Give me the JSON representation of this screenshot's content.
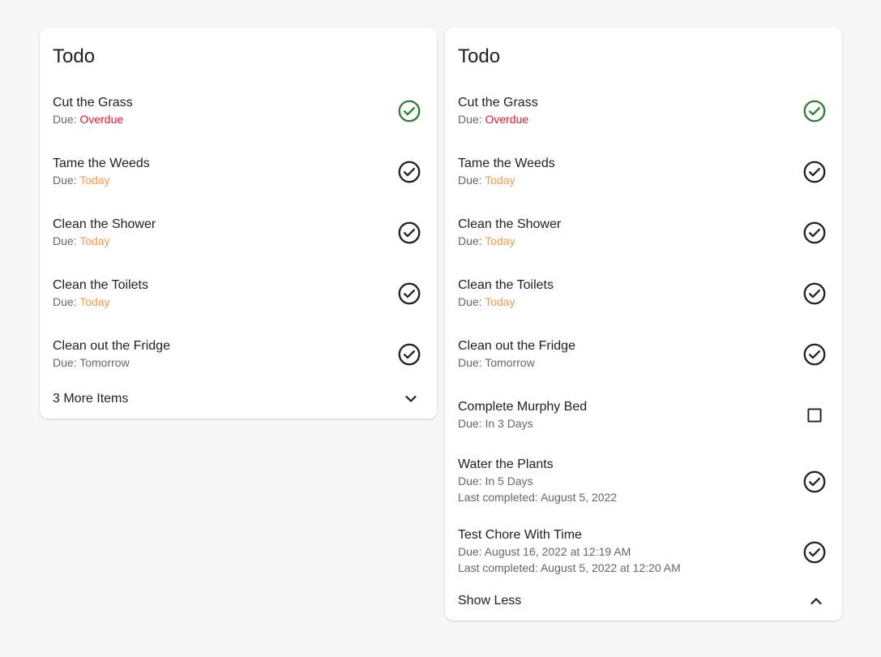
{
  "colors": {
    "complete_green": "#2e7d32",
    "overdue_red": "#e0162b",
    "today_orange": "#f2994a",
    "text_primary": "#212121",
    "text_secondary": "#666666"
  },
  "due_prefix": "Due: ",
  "left_card": {
    "title": "Todo",
    "items": [
      {
        "name": "Cut the Grass",
        "due": "Overdue",
        "status_icon": "check-circle-icon"
      },
      {
        "name": "Tame the Weeds",
        "due": "Today",
        "status_icon": "check-circle-icon"
      },
      {
        "name": "Clean the Shower",
        "due": "Today",
        "status_icon": "check-circle-icon"
      },
      {
        "name": "Clean the Toilets",
        "due": "Today",
        "status_icon": "check-circle-icon"
      },
      {
        "name": "Clean out the Fridge",
        "due": "Tomorrow",
        "status_icon": "check-circle-icon"
      }
    ],
    "footer_label": "3 More Items",
    "footer_icon": "chevron-down-icon"
  },
  "right_card": {
    "title": "Todo",
    "items": [
      {
        "name": "Cut the Grass",
        "due": "Overdue",
        "status_icon": "check-circle-icon"
      },
      {
        "name": "Tame the Weeds",
        "due": "Today",
        "status_icon": "check-circle-icon"
      },
      {
        "name": "Clean the Shower",
        "due": "Today",
        "status_icon": "check-circle-icon"
      },
      {
        "name": "Clean the Toilets",
        "due": "Today",
        "status_icon": "check-circle-icon"
      },
      {
        "name": "Clean out the Fridge",
        "due": "Tomorrow",
        "status_icon": "check-circle-icon"
      },
      {
        "name": "Complete Murphy Bed",
        "due": "In 3 Days",
        "status_icon": "checkbox-icon"
      },
      {
        "name": "Water the Plants",
        "due": "In 5 Days",
        "last_completed": "Last completed: August 5, 2022",
        "status_icon": "check-circle-icon"
      },
      {
        "name": "Test Chore With Time",
        "due": "August 16, 2022 at 12:19 AM",
        "last_completed": "Last completed: August 5, 2022 at 12:20 AM",
        "status_icon": "check-circle-icon"
      }
    ],
    "footer_label": "Show Less",
    "footer_icon": "chevron-up-icon"
  }
}
